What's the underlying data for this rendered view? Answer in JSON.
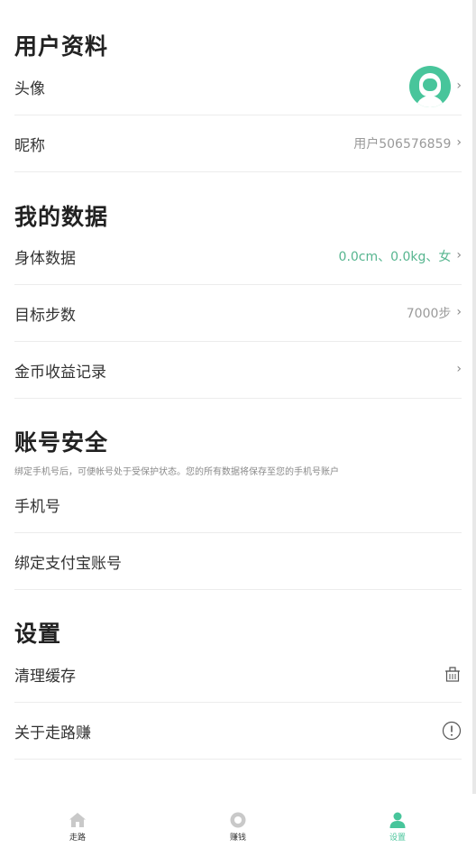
{
  "profile": {
    "title": "用户资料",
    "avatar_label": "头像",
    "nickname_label": "昵称",
    "nickname_value": "用户506576859"
  },
  "my_data": {
    "title": "我的数据",
    "body_label": "身体数据",
    "body_value": "0.0cm、0.0kg、女",
    "steps_label": "目标步数",
    "steps_value": "7000步",
    "coins_label": "金币收益记录"
  },
  "account": {
    "title": "账号安全",
    "note": "绑定手机号后，可便帐号处于受保护状态。您的所有数据将保存至您的手机号账户",
    "phone_label": "手机号",
    "alipay_label": "绑定支付宝账号"
  },
  "settings": {
    "title": "设置",
    "clear_cache_label": "清理缓存",
    "about_label": "关于走路赚"
  },
  "tabs": [
    {
      "label": "走路",
      "icon": "home-icon"
    },
    {
      "label": "赚钱",
      "icon": "coin-icon"
    },
    {
      "label": "设置",
      "icon": "person-icon",
      "active": true
    }
  ],
  "colors": {
    "accent": "#48c59b",
    "value_green": "#56b58f",
    "muted": "#9a9a9a"
  }
}
